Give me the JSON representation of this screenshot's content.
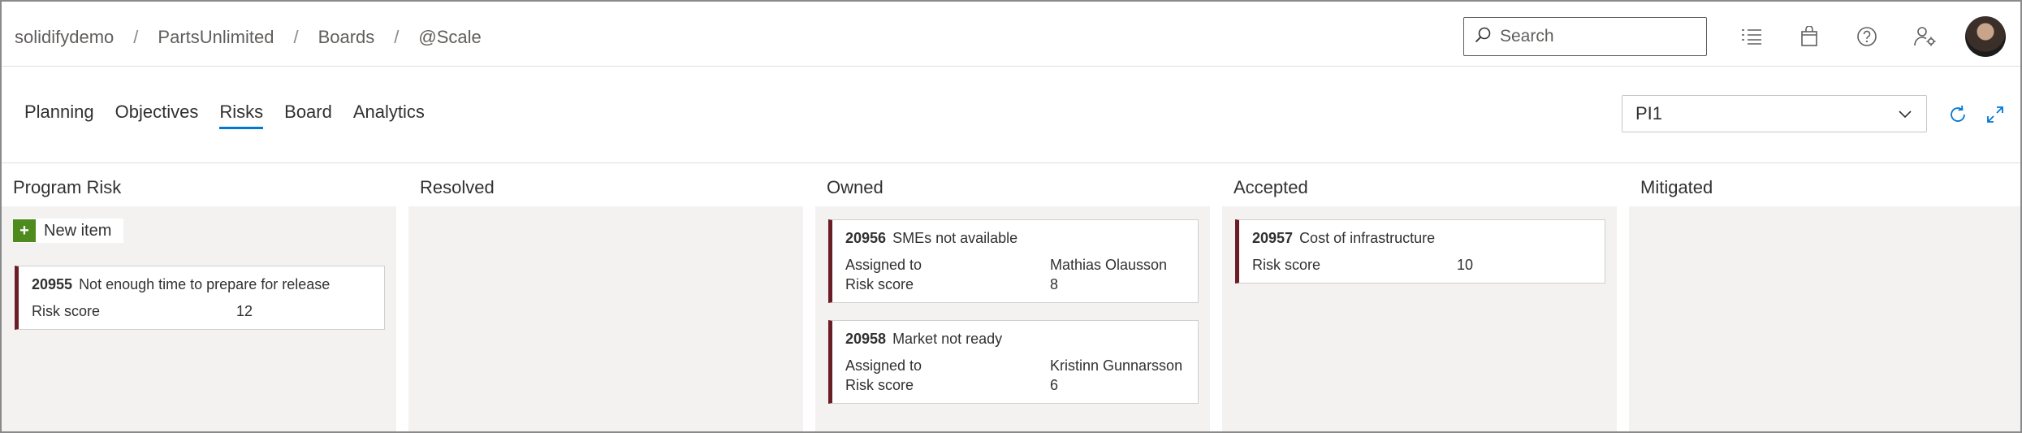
{
  "breadcrumb": [
    "solidifydemo",
    "PartsUnlimited",
    "Boards",
    "@Scale"
  ],
  "search": {
    "placeholder": "Search"
  },
  "header_icons": [
    "task-list-icon",
    "shopping-bag-icon",
    "help-icon",
    "user-settings-icon"
  ],
  "tabs": [
    {
      "label": "Planning",
      "active": false
    },
    {
      "label": "Objectives",
      "active": false
    },
    {
      "label": "Risks",
      "active": true
    },
    {
      "label": "Board",
      "active": false
    },
    {
      "label": "Analytics",
      "active": false
    }
  ],
  "iteration_select": {
    "value": "PI1"
  },
  "colors": {
    "accent": "#0078d4",
    "card_bar": "#6b1c24",
    "new_item_green": "#4e8b1e",
    "column_bg": "#f3f2f1"
  },
  "columns": [
    {
      "title": "Program Risk",
      "new_item_label": "New item",
      "cards": [
        {
          "id": "20955",
          "title": "Not enough time to prepare for release",
          "fields": [
            {
              "label": "Risk score",
              "value": "12"
            }
          ]
        }
      ]
    },
    {
      "title": "Resolved",
      "cards": []
    },
    {
      "title": "Owned",
      "cards": [
        {
          "id": "20956",
          "title": "SMEs not available",
          "fields": [
            {
              "label": "Assigned to",
              "value": "Mathias Olausson"
            },
            {
              "label": "Risk score",
              "value": "8"
            }
          ]
        },
        {
          "id": "20958",
          "title": "Market not ready",
          "fields": [
            {
              "label": "Assigned to",
              "value": "Kristinn Gunnarsson"
            },
            {
              "label": "Risk score",
              "value": "6"
            }
          ]
        }
      ]
    },
    {
      "title": "Accepted",
      "cards": [
        {
          "id": "20957",
          "title": "Cost of infrastructure",
          "fields": [
            {
              "label": "Risk score",
              "value": "10"
            }
          ]
        }
      ]
    },
    {
      "title": "Mitigated",
      "cards": []
    }
  ]
}
